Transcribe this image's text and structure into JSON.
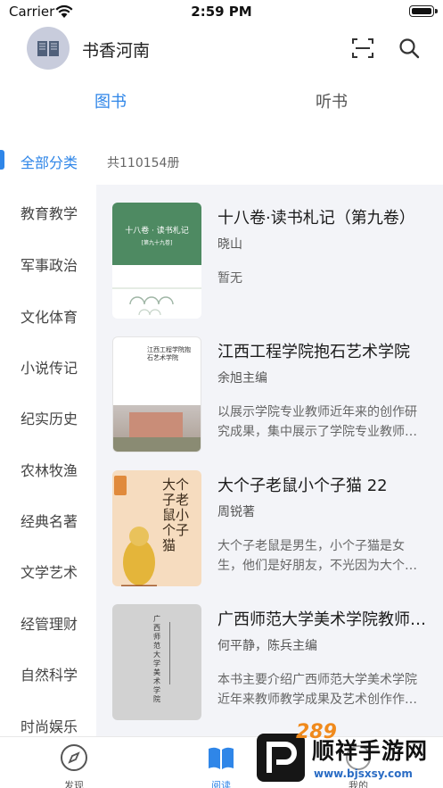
{
  "status_bar": {
    "carrier": "Carrier",
    "time": "2:59 PM"
  },
  "header": {
    "library_name": "书香河南",
    "icons": [
      "book-icon",
      "scan-icon",
      "search-icon"
    ]
  },
  "tabs": [
    {
      "label": "图书",
      "active": true
    },
    {
      "label": "听书",
      "active": false
    }
  ],
  "sidebar": {
    "items": [
      {
        "label": "全部分类",
        "active": true
      },
      {
        "label": "教育教学"
      },
      {
        "label": "军事政治"
      },
      {
        "label": "文化体育"
      },
      {
        "label": "小说传记"
      },
      {
        "label": "纪实历史"
      },
      {
        "label": "农林牧渔"
      },
      {
        "label": "经典名著"
      },
      {
        "label": "文学艺术"
      },
      {
        "label": "经管理财"
      },
      {
        "label": "自然科学"
      },
      {
        "label": "时尚娱乐"
      }
    ]
  },
  "list": {
    "count": "共110154册",
    "books": [
      {
        "title": "十八卷·读书札记（第九卷）",
        "author": "晓山",
        "desc": "暂无",
        "cover_text": "十八卷 · 读书札记",
        "cover_sub": "[第九十九卷]"
      },
      {
        "title": "江西工程学院抱石艺术学院",
        "author": "余旭主编",
        "desc": "以展示学院专业教师近年来的创作研究成果，集中展示了学院专业教师的艺术风貌。",
        "cover_text": "江西工程学院抱石艺术学院"
      },
      {
        "title": "大个子老鼠小个子猫 22",
        "author": "周锐著",
        "desc": "大个子老鼠是男生，小个子猫是女生，他们是好朋友，不光因为大个子老鼠和小个子猫……",
        "cover_text": "大个子老鼠小个子猫"
      },
      {
        "title": "广西师范大学美术学院教师作品集",
        "author": "何平静，陈兵主编",
        "desc": "本书主要介绍广西师范大学美术学院近年来教师教学成果及艺术创作作品。",
        "cover_text": "广西师范大学美术学院"
      }
    ]
  },
  "bottom_nav": [
    {
      "label": "发现",
      "icon": "compass-icon",
      "active": false
    },
    {
      "label": "阅读",
      "icon": "book-open-icon",
      "active": true
    },
    {
      "label": "我的",
      "icon": "profile-icon",
      "active": false
    }
  ],
  "watermark": {
    "brand": "顺祥手游网",
    "number": "289",
    "url": "www.bjsxsy.com"
  },
  "colors": {
    "accent": "#2f86e8",
    "list_bg": "#f3f4f8",
    "watermark_orange": "#f08a1c"
  }
}
